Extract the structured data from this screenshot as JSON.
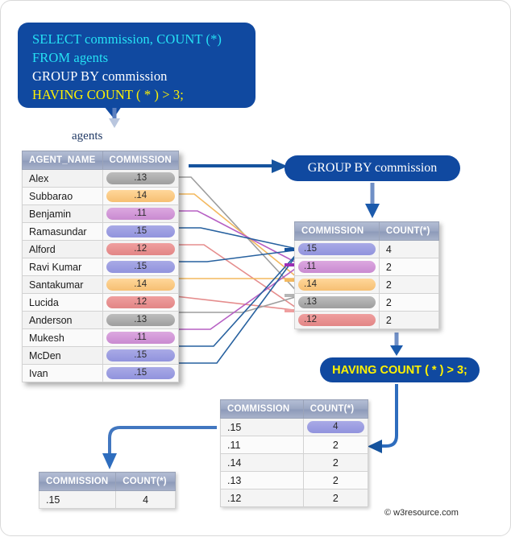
{
  "sql": {
    "lines": [
      {
        "text": "SELECT commission, COUNT (*)",
        "color": "cyan"
      },
      {
        "text": "FROM agents",
        "color": "cyan"
      },
      {
        "text": "GROUP BY commission",
        "color": "white"
      },
      {
        "text": "HAVING COUNT ( * ) > 3;",
        "color": "yellow"
      }
    ]
  },
  "labels": {
    "agents_caption": "agents",
    "group_by_box": "GROUP BY commission",
    "having_box": "HAVING COUNT ( * ) > 3;",
    "credit": "© w3resource.com"
  },
  "agents_table": {
    "headers": [
      "AGENT_NAME",
      "COMMISSION"
    ],
    "rows": [
      {
        "name": "Alex",
        "commission": ".13",
        "color_class": "c13"
      },
      {
        "name": "Subbarao",
        "commission": ".14",
        "color_class": "c14"
      },
      {
        "name": "Benjamin",
        "commission": ".11",
        "color_class": "c11"
      },
      {
        "name": "Ramasundar",
        "commission": ".15",
        "color_class": "c15"
      },
      {
        "name": "Alford",
        "commission": ".12",
        "color_class": "c12"
      },
      {
        "name": "Ravi Kumar",
        "commission": ".15",
        "color_class": "c15"
      },
      {
        "name": "Santakumar",
        "commission": ".14",
        "color_class": "c14"
      },
      {
        "name": "Lucida",
        "commission": ".12",
        "color_class": "c12"
      },
      {
        "name": "Anderson",
        "commission": ".13",
        "color_class": "c13"
      },
      {
        "name": "Mukesh",
        "commission": ".11",
        "color_class": "c11"
      },
      {
        "name": "McDen",
        "commission": ".15",
        "color_class": "c15"
      },
      {
        "name": "Ivan",
        "commission": ".15",
        "color_class": "c15"
      }
    ]
  },
  "group_table": {
    "headers": [
      "COMMISSION",
      "COUNT(*)"
    ],
    "rows": [
      {
        "commission": ".15",
        "count": "4",
        "color_class": "c15"
      },
      {
        "commission": ".11",
        "count": "2",
        "color_class": "c11"
      },
      {
        "commission": ".14",
        "count": "2",
        "color_class": "c14"
      },
      {
        "commission": ".13",
        "count": "2",
        "color_class": "c13"
      },
      {
        "commission": ".12",
        "count": "2",
        "color_class": "c12"
      }
    ]
  },
  "having_table": {
    "headers": [
      "COMMISSION",
      "COUNT(*)"
    ],
    "rows": [
      {
        "commission": ".15",
        "count": "4",
        "highlight": true
      },
      {
        "commission": ".11",
        "count": "2",
        "highlight": false
      },
      {
        "commission": ".14",
        "count": "2",
        "highlight": false
      },
      {
        "commission": ".13",
        "count": "2",
        "highlight": false
      },
      {
        "commission": ".12",
        "count": "2",
        "highlight": false
      }
    ]
  },
  "final_table": {
    "headers": [
      "COMMISSION",
      "COUNT(*)"
    ],
    "rows": [
      {
        "commission": ".15",
        "count": "4"
      }
    ]
  },
  "colors": {
    "brand_blue": "#1049A0",
    "arrow_blue": "#15539E",
    "cyan_text": "#25E2F5",
    "yellow_text": "#FFF200",
    "header_grey_blue": "#9aa6c2"
  }
}
